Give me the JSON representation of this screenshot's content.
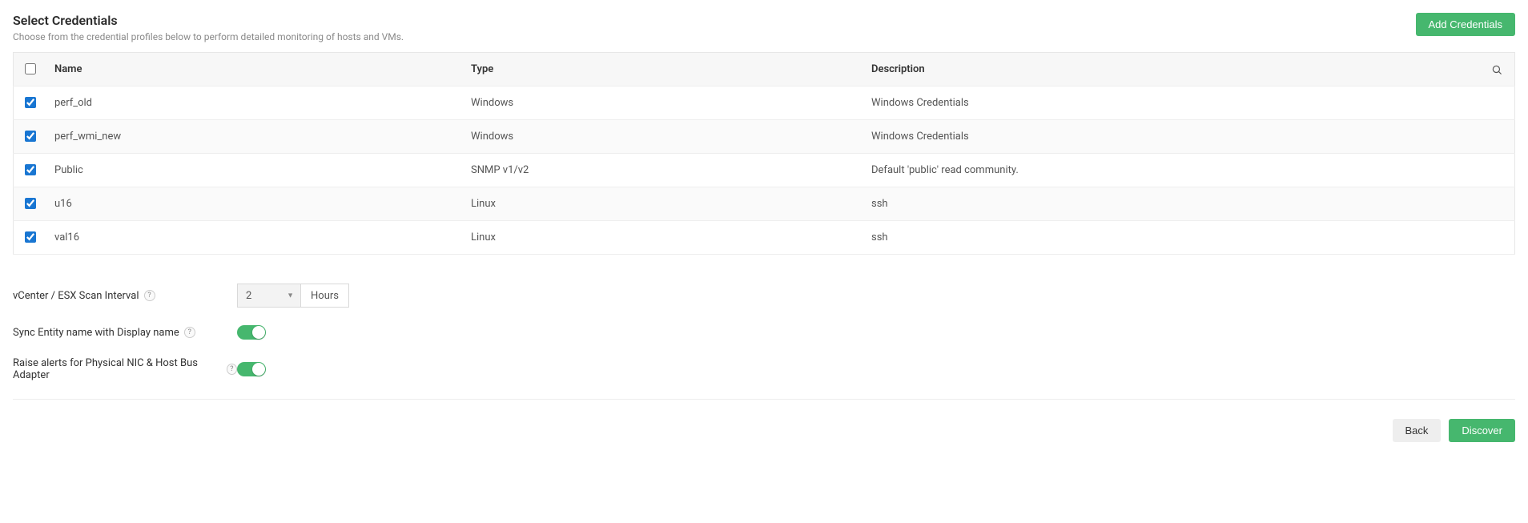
{
  "header": {
    "title": "Select Credentials",
    "subtitle": "Choose from the credential profiles below to perform detailed monitoring of hosts and VMs.",
    "add_button": "Add Credentials"
  },
  "table": {
    "columns": {
      "name": "Name",
      "type": "Type",
      "description": "Description"
    },
    "rows": [
      {
        "checked": true,
        "name": "perf_old",
        "type": "Windows",
        "description": "Windows Credentials"
      },
      {
        "checked": true,
        "name": "perf_wmi_new",
        "type": "Windows",
        "description": "Windows Credentials"
      },
      {
        "checked": true,
        "name": "Public",
        "type": "SNMP v1/v2",
        "description": "Default 'public' read community."
      },
      {
        "checked": true,
        "name": "u16",
        "type": "Linux",
        "description": "ssh"
      },
      {
        "checked": true,
        "name": "val16",
        "type": "Linux",
        "description": "ssh"
      }
    ]
  },
  "settings": {
    "scan_interval_label": "vCenter / ESX Scan Interval",
    "scan_interval_value": "2",
    "scan_interval_unit": "Hours",
    "sync_label": "Sync Entity name with Display name",
    "sync_on": true,
    "raise_label": "Raise alerts for Physical NIC & Host Bus Adapter",
    "raise_on": true
  },
  "footer": {
    "back": "Back",
    "discover": "Discover"
  },
  "help_glyph": "?"
}
